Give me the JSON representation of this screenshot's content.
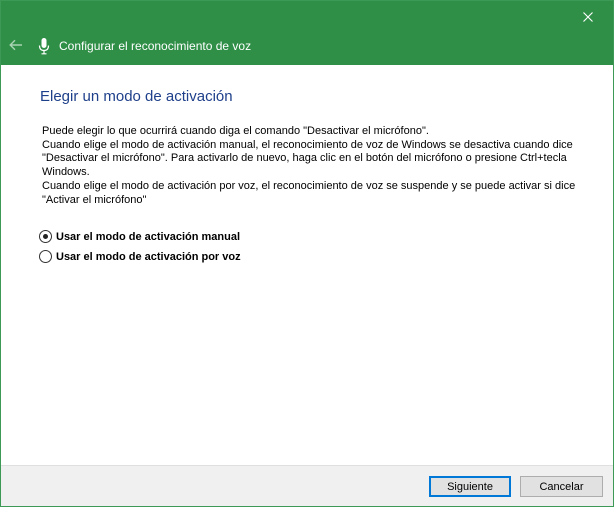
{
  "window": {
    "title": "Configurar el reconocimiento de voz",
    "accent_color": "#2f8f47"
  },
  "icons": {
    "close": "close-icon",
    "back": "back-arrow-icon",
    "app": "microphone-icon"
  },
  "page": {
    "heading": "Elegir un modo de activación",
    "description": [
      "Puede elegir lo que ocurrirá cuando diga el comando \"Desactivar el micrófono\".",
      "Cuando elige el modo de activación manual, el reconocimiento de voz de Windows se desactiva cuando dice \"Desactivar el micrófono\". Para activarlo de nuevo, haga clic en el botón del micrófono o presione Ctrl+tecla Windows.",
      "Cuando elige el modo de activación por voz, el reconocimiento de voz se suspende y se puede activar si dice \"Activar el micrófono\""
    ],
    "options": [
      {
        "label": "Usar el modo de activación manual",
        "selected": true
      },
      {
        "label": "Usar el modo de activación por voz",
        "selected": false
      }
    ]
  },
  "footer": {
    "next_label": "Siguiente",
    "cancel_label": "Cancelar"
  }
}
